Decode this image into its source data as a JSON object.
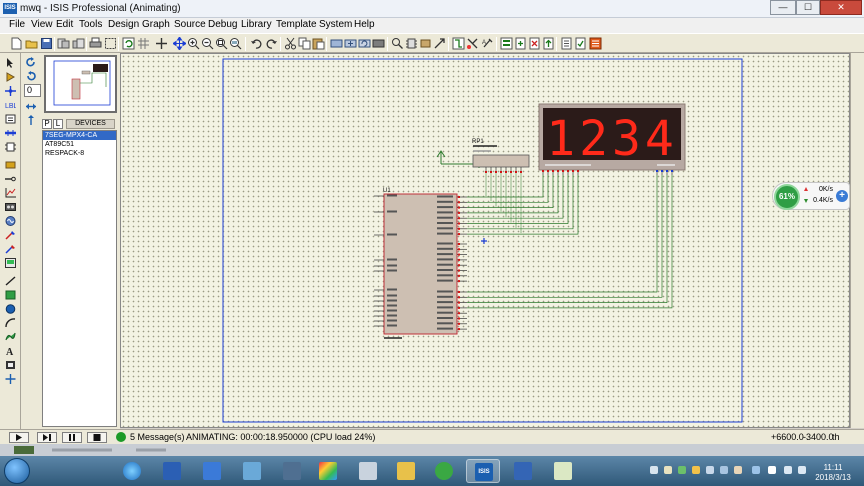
{
  "window": {
    "title": "mwq - ISIS Professional (Animating)",
    "app_icon_text": "ISIS",
    "minimize": "—",
    "maximize": "☐",
    "close": "✕"
  },
  "menu": [
    "File",
    "View",
    "Edit",
    "Tools",
    "Design",
    "Graph",
    "Source",
    "Debug",
    "Library",
    "Template",
    "System",
    "Help"
  ],
  "side_panel": {
    "rotation_value": "0",
    "lib_p": "P",
    "lib_l": "L",
    "devices_header": "DEVICES",
    "devices": [
      "7SEG-MPX4-CA",
      "AT89C51",
      "RESPACK-8"
    ],
    "selected_device": 0
  },
  "schematic": {
    "mcu_ref": "U1",
    "respack_ref": "RP1",
    "display_digits": "1234",
    "accent_colors": {
      "display_segments": "#ff2a1a",
      "display_body": "#2b1b19",
      "chip_fill": "#cdbfb2",
      "chip_border": "#c0303a",
      "wire": "#2c7a2c",
      "pin_marker_red": "#d11414",
      "pin_marker_blue": "#1b3dd4"
    }
  },
  "net_widget": {
    "percent": "61%",
    "up_rate": "0K/s",
    "down_rate": "0.4K/s"
  },
  "statusbar": {
    "messages": "5 Message(s)",
    "animation": "ANIMATING: 00:00:18.950000 (CPU load 24%)",
    "coord_x": "+6600.0",
    "coord_y": "-3400.0",
    "coord_unit": "th"
  },
  "taskbar": {
    "time": "11:11",
    "date": "2018/3/13",
    "active_app": "ISIS"
  }
}
